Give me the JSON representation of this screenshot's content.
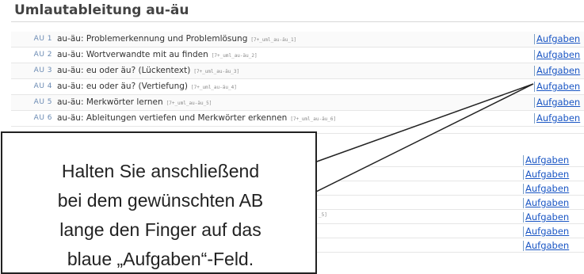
{
  "section_title": "Umlautableitung au-äu",
  "rows": [
    {
      "code": "AU 1",
      "desc": "au-äu: Problemerkennung und Problemlösung",
      "tag": "[7+_uml_au-äu_1]",
      "link": "Aufgaben"
    },
    {
      "code": "AU 2",
      "desc": "au-äu: Wortverwandte mit au finden",
      "tag": "[7+_uml_au-äu_2]",
      "link": "Aufgaben"
    },
    {
      "code": "AU 3",
      "desc": "au-äu: eu oder äu? (Lückentext)",
      "tag": "[7+_uml_au-äu_3]",
      "link": "Aufgaben"
    },
    {
      "code": "AU 4",
      "desc": "au-äu: eu oder äu? (Vertiefung)",
      "tag": "[7+_uml_au-äu_4]",
      "link": "Aufgaben"
    },
    {
      "code": "AU 5",
      "desc": "au-äu: Merkwörter lernen",
      "tag": "[7+_uml_au-äu_5]",
      "link": "Aufgaben"
    },
    {
      "code": "AU 6",
      "desc": "au-äu: Ableitungen vertiefen und Merkwörter erkennen",
      "tag": "[7+_uml_au-äu_6]",
      "link": "Aufgaben"
    }
  ],
  "lower_rows": [
    {
      "fragment": "",
      "link": "Aufgaben"
    },
    {
      "fragment": "",
      "link": "Aufgaben"
    },
    {
      "fragment": "",
      "link": "Aufgaben"
    },
    {
      "fragment": "",
      "link": "Aufgaben"
    },
    {
      "fragment": "_5]",
      "link": "Aufgaben"
    },
    {
      "fragment": "",
      "link": "Aufgaben"
    },
    {
      "fragment": "",
      "link": "Aufgaben"
    }
  ],
  "callout": {
    "line1": "Halten Sie anschließend",
    "line2": "bei dem gewünschten AB",
    "line3": "lange den Finger auf das",
    "line4": "blaue „Aufgaben“-Feld."
  }
}
